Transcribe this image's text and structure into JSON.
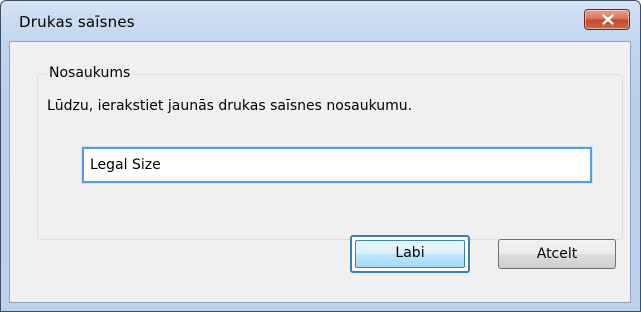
{
  "window": {
    "title": "Drukas saīsnes"
  },
  "group": {
    "legend": "Nosaukums",
    "instruction": "Lūdzu, ierakstiet jaunās drukas saīsnes nosaukumu."
  },
  "name_field": {
    "value": "Legal Size"
  },
  "buttons": {
    "ok_label": "Labi",
    "cancel_label": "Atcelt"
  },
  "icons": {
    "close": "close-icon"
  },
  "colors": {
    "title_bar": "#c3d6ee",
    "client_bg": "#f0f0f0",
    "close_button": "#c2472b",
    "focus_border": "#569de5",
    "default_button_border": "#3c7fb1"
  }
}
